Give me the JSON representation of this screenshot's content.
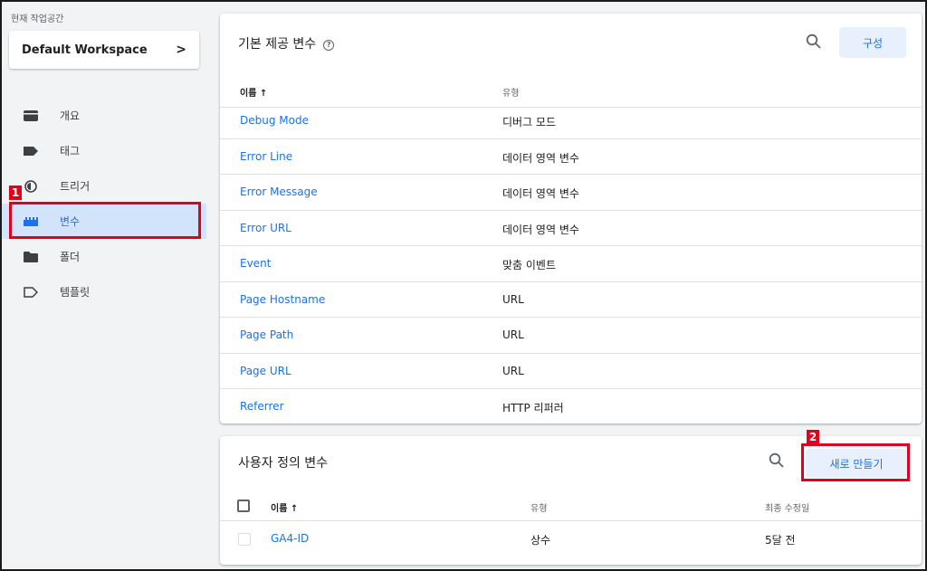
{
  "workspace": {
    "caption": "현재 작업공간",
    "name": "Default Workspace",
    "chevron": ">"
  },
  "sidebar": {
    "items": [
      {
        "label": "개요",
        "icon": "overview-icon",
        "active": false
      },
      {
        "label": "태그",
        "icon": "tag-icon",
        "active": false
      },
      {
        "label": "트리거",
        "icon": "trigger-icon",
        "active": false
      },
      {
        "label": "변수",
        "icon": "variable-icon",
        "active": true
      },
      {
        "label": "폴더",
        "icon": "folder-icon",
        "active": false
      },
      {
        "label": "템플릿",
        "icon": "template-icon",
        "active": false
      }
    ]
  },
  "builtin": {
    "title": "기본 제공 변수",
    "help_icon": "?",
    "config_label": "구성",
    "columns": {
      "name": "이름 ↑",
      "type": "유형"
    },
    "rows": [
      {
        "name": "Debug Mode",
        "type": "디버그 모드"
      },
      {
        "name": "Error Line",
        "type": "데이터 영역 변수"
      },
      {
        "name": "Error Message",
        "type": "데이터 영역 변수"
      },
      {
        "name": "Error URL",
        "type": "데이터 영역 변수"
      },
      {
        "name": "Event",
        "type": "맞춤 이벤트"
      },
      {
        "name": "Page Hostname",
        "type": "URL"
      },
      {
        "name": "Page Path",
        "type": "URL"
      },
      {
        "name": "Page URL",
        "type": "URL"
      },
      {
        "name": "Referrer",
        "type": "HTTP 리퍼러"
      }
    ]
  },
  "user": {
    "title": "사용자 정의 변수",
    "new_label": "새로 만들기",
    "columns": {
      "name": "이름 ↑",
      "type": "유형",
      "modified": "최종 수정일"
    },
    "rows": [
      {
        "name": "GA4-ID",
        "type": "상수",
        "modified": "5달 전"
      }
    ]
  },
  "annotations": {
    "marker1": "1",
    "marker2": "2",
    "color": "#e2001a"
  },
  "colors": {
    "accent": "#1a73e8",
    "active_bg": "#d2e3fc",
    "button_bg": "#e8f0fe"
  }
}
